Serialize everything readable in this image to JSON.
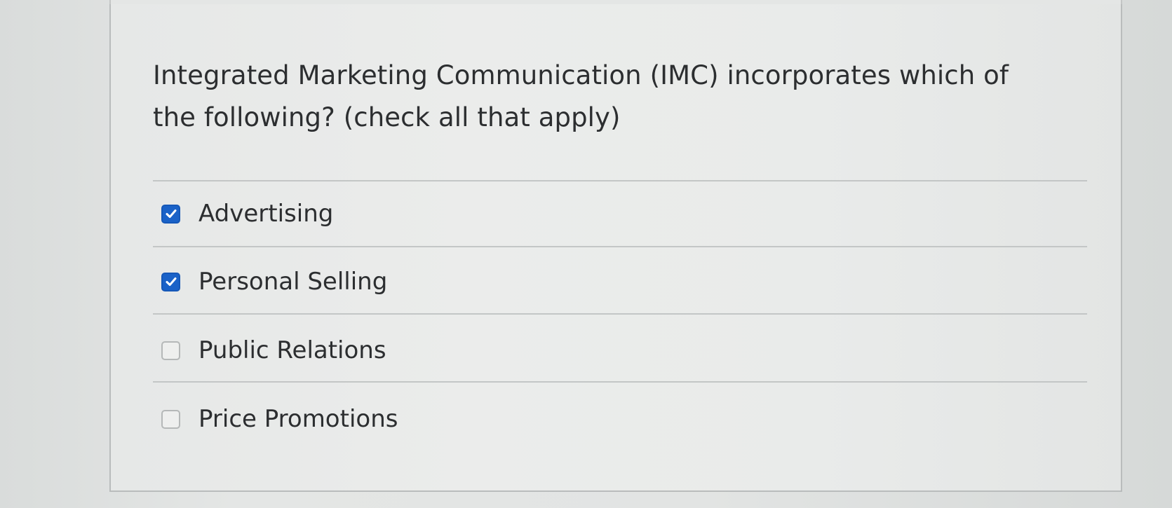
{
  "question": {
    "text": "Integrated Marketing Communication (IMC) incorporates which of the following?  (check all that apply)"
  },
  "answers": [
    {
      "label": "Advertising",
      "checked": true
    },
    {
      "label": "Personal Selling",
      "checked": true
    },
    {
      "label": "Public Relations",
      "checked": false
    },
    {
      "label": "Price Promotions",
      "checked": false
    }
  ],
  "colors": {
    "checkbox_checked": "#1a62c8",
    "text": "#2c2e30"
  }
}
